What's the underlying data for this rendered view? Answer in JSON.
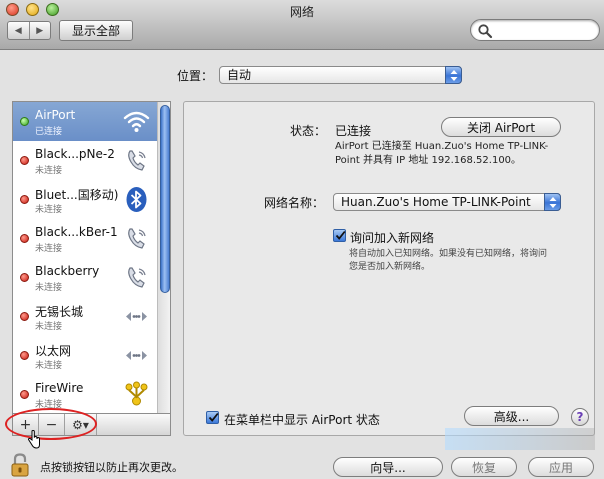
{
  "window": {
    "title": "网络"
  },
  "toolbar": {
    "show_all": "显示全部",
    "search_placeholder": ""
  },
  "location": {
    "label": "位置：",
    "value": "自动"
  },
  "services": [
    {
      "name": "AirPort",
      "status": "已连接",
      "indicator": "green",
      "icon": "wifi-icon"
    },
    {
      "name": "Black...pNe-2",
      "status": "未连接",
      "indicator": "red",
      "icon": "phone-icon"
    },
    {
      "name": "Bluet...国移动)",
      "status": "未连接",
      "indicator": "red",
      "icon": "bluetooth-icon"
    },
    {
      "name": "Black...kBer-1",
      "status": "未连接",
      "indicator": "red",
      "icon": "phone-icon"
    },
    {
      "name": "Blackberry",
      "status": "未连接",
      "indicator": "red",
      "icon": "phone-icon"
    },
    {
      "name": "无锡长城",
      "status": "未连接",
      "indicator": "red",
      "icon": "vpn-icon"
    },
    {
      "name": "以太网",
      "status": "未连接",
      "indicator": "red",
      "icon": "ethernet-icon"
    },
    {
      "name": "FireWire",
      "status": "未连接",
      "indicator": "red",
      "icon": "firewire-icon"
    }
  ],
  "list_buttons": {
    "add": "+",
    "remove": "−",
    "gear": "⚙▾"
  },
  "detail": {
    "status_label": "状态：",
    "status_value": "已连接",
    "toggle_button": "关闭 AirPort",
    "status_line1": "AirPort 已连接至 Huan.Zuo's Home TP-LINK-",
    "status_line2": "Point 并具有 IP 地址 192.168.52.100。",
    "network_label": "网络名称：",
    "network_value": "Huan.Zuo's Home TP-LINK-Point",
    "ask_join_label": "询问加入新网络",
    "ask_join_checked": true,
    "ask_join_desc1": "将自动加入已知网络。如果没有已知网络，将询问",
    "ask_join_desc2": "您是否加入新网络。",
    "menubar_label": "在菜单栏中显示 AirPort 状态",
    "menubar_checked": true,
    "advanced_button": "高级...",
    "help": "?"
  },
  "bottom": {
    "lock_text": "点按锁按钮以防止再次更改。",
    "assist_button": "向导...",
    "revert_button": "恢复",
    "apply_button": "应用"
  },
  "colors": {
    "selection": "#7a9bd0",
    "accent": "#3a74d6",
    "annotation": "#dd2222"
  }
}
